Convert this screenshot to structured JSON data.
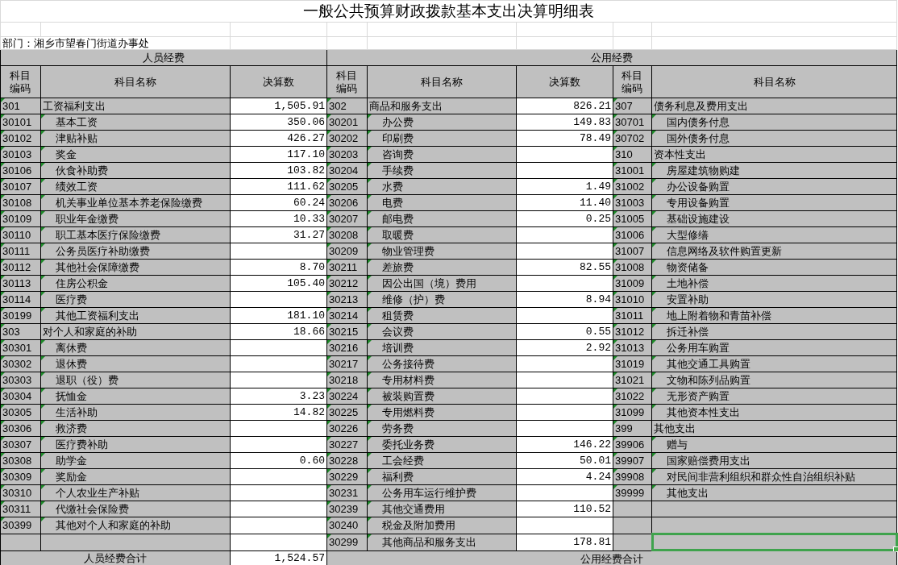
{
  "title": "一般公共预算财政拨款基本支出决算明细表",
  "department": "部门：湘乡市望春门街道办事处",
  "personnel": {
    "heading": "人员经费",
    "columns": [
      "科目编码",
      "科目名称",
      "决算数"
    ],
    "items": [
      {
        "code": "301",
        "name": "工资福利支出",
        "amount": "1,505.91",
        "children": [
          {
            "code": "30101",
            "name": "基本工资",
            "amount": "350.06"
          },
          {
            "code": "30102",
            "name": "津贴补贴",
            "amount": "426.27"
          },
          {
            "code": "30103",
            "name": "奖金",
            "amount": "117.10"
          },
          {
            "code": "30106",
            "name": "伙食补助费",
            "amount": "103.82"
          },
          {
            "code": "30107",
            "name": "绩效工资",
            "amount": "111.62"
          },
          {
            "code": "30108",
            "name": "机关事业单位基本养老保险缴费",
            "amount": "60.24"
          },
          {
            "code": "30109",
            "name": "职业年金缴费",
            "amount": "10.33"
          },
          {
            "code": "30110",
            "name": "职工基本医疗保险缴费",
            "amount": "31.27"
          },
          {
            "code": "30111",
            "name": "公务员医疗补助缴费"
          },
          {
            "code": "30112",
            "name": "其他社会保障缴费",
            "amount": "8.70"
          },
          {
            "code": "30113",
            "name": "住房公积金",
            "amount": "105.40"
          },
          {
            "code": "30114",
            "name": "医疗费"
          },
          {
            "code": "30199",
            "name": "其他工资福利支出",
            "amount": "181.10"
          }
        ]
      },
      {
        "code": "303",
        "name": "对个人和家庭的补助",
        "amount": "18.66",
        "children": [
          {
            "code": "30301",
            "name": "离休费"
          },
          {
            "code": "30302",
            "name": "退休费"
          },
          {
            "code": "30303",
            "name": "退职（役）费"
          },
          {
            "code": "30304",
            "name": "抚恤金",
            "amount": "3.23"
          },
          {
            "code": "30305",
            "name": "生活补助",
            "amount": "14.82"
          },
          {
            "code": "30306",
            "name": "救济费"
          },
          {
            "code": "30307",
            "name": "医疗费补助"
          },
          {
            "code": "30308",
            "name": "助学金",
            "amount": "0.60"
          },
          {
            "code": "30309",
            "name": "奖励金"
          },
          {
            "code": "30310",
            "name": "个人农业生产补贴"
          },
          {
            "code": "30311",
            "name": "代缴社会保险费"
          },
          {
            "code": "30399",
            "name": "其他对个人和家庭的补助"
          }
        ]
      }
    ],
    "total_label": "人员经费合计",
    "total_amount": "1,524.57"
  },
  "public": {
    "heading": "公用经费",
    "columns": [
      "科目编码",
      "科目名称",
      "决算数",
      "科目编码",
      "科目名称"
    ],
    "goods": [
      {
        "code": "302",
        "name": "商品和服务支出",
        "amount": "826.21",
        "children": [
          {
            "code": "30201",
            "name": "办公费",
            "amount": "149.83"
          },
          {
            "code": "30202",
            "name": "印刷费",
            "amount": "78.49"
          },
          {
            "code": "30203",
            "name": "咨询费"
          },
          {
            "code": "30204",
            "name": "手续费"
          },
          {
            "code": "30205",
            "name": "水费",
            "amount": "1.49"
          },
          {
            "code": "30206",
            "name": "电费",
            "amount": "11.40"
          },
          {
            "code": "30207",
            "name": "邮电费",
            "amount": "0.25"
          },
          {
            "code": "30208",
            "name": "取暖费"
          },
          {
            "code": "30209",
            "name": "物业管理费"
          },
          {
            "code": "30211",
            "name": "差旅费",
            "amount": "82.55"
          },
          {
            "code": "30212",
            "name": "因公出国（境）费用"
          },
          {
            "code": "30213",
            "name": "维修（护）费",
            "amount": "8.94"
          },
          {
            "code": "30214",
            "name": "租赁费"
          },
          {
            "code": "30215",
            "name": "会议费",
            "amount": "0.55"
          },
          {
            "code": "30216",
            "name": "培训费",
            "amount": "2.92"
          },
          {
            "code": "30217",
            "name": "公务接待费"
          },
          {
            "code": "30218",
            "name": "专用材料费"
          },
          {
            "code": "30224",
            "name": "被装购置费"
          },
          {
            "code": "30225",
            "name": "专用燃料费"
          },
          {
            "code": "30226",
            "name": "劳务费"
          },
          {
            "code": "30227",
            "name": "委托业务费",
            "amount": "146.22"
          },
          {
            "code": "30228",
            "name": "工会经费",
            "amount": "50.01"
          },
          {
            "code": "30229",
            "name": "福利费",
            "amount": "4.24"
          },
          {
            "code": "30231",
            "name": "公务用车运行维护费"
          },
          {
            "code": "30239",
            "name": "其他交通费用",
            "amount": "110.52"
          },
          {
            "code": "30240",
            "name": "税金及附加费用"
          },
          {
            "code": "30299",
            "name": "其他商品和服务支出",
            "amount": "178.81"
          }
        ]
      }
    ],
    "other": [
      {
        "code": "307",
        "name": "债务利息及费用支出",
        "children": [
          {
            "code": "30701",
            "name": "国内债务付息"
          },
          {
            "code": "30702",
            "name": "国外债务付息"
          }
        ]
      },
      {
        "code": "310",
        "name": "资本性支出",
        "children": [
          {
            "code": "31001",
            "name": "房屋建筑物购建"
          },
          {
            "code": "31002",
            "name": "办公设备购置"
          },
          {
            "code": "31003",
            "name": "专用设备购置"
          },
          {
            "code": "31005",
            "name": "基础设施建设"
          },
          {
            "code": "31006",
            "name": "大型修缮"
          },
          {
            "code": "31007",
            "name": "信息网络及软件购置更新"
          },
          {
            "code": "31008",
            "name": "物资储备"
          },
          {
            "code": "31009",
            "name": "土地补偿"
          },
          {
            "code": "31010",
            "name": "安置补助"
          },
          {
            "code": "31011",
            "name": "地上附着物和青苗补偿"
          },
          {
            "code": "31012",
            "name": "拆迁补偿"
          },
          {
            "code": "31013",
            "name": "公务用车购置"
          },
          {
            "code": "31019",
            "name": "其他交通工具购置"
          },
          {
            "code": "31021",
            "name": "文物和陈列品购置"
          },
          {
            "code": "31022",
            "name": "无形资产购置"
          },
          {
            "code": "31099",
            "name": "其他资本性支出"
          }
        ]
      },
      {
        "code": "399",
        "name": "其他支出",
        "children": [
          {
            "code": "39906",
            "name": "赠与"
          },
          {
            "code": "39907",
            "name": "国家赔偿费用支出"
          },
          {
            "code": "39908",
            "name": "对民间非营利组织和群众性自治组织补贴"
          },
          {
            "code": "39999",
            "name": "其他支出"
          }
        ]
      }
    ],
    "blank_rows": [
      {
        "selected": false
      },
      {
        "selected": false
      },
      {
        "selected": true
      }
    ],
    "total_label": "公用经费合计"
  }
}
